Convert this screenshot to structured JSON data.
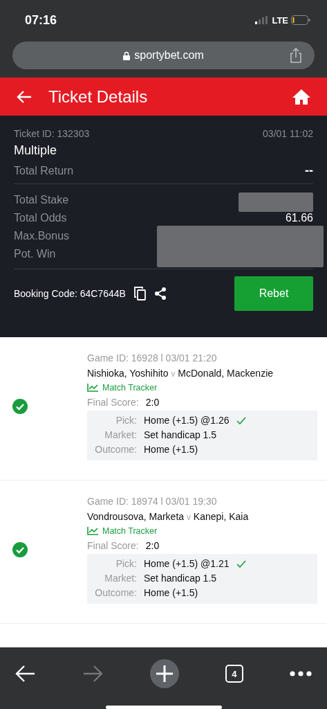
{
  "status_bar": {
    "time": "07:16",
    "network": "LTE"
  },
  "browser": {
    "url": "sportybet.com"
  },
  "header": {
    "title": "Ticket Details"
  },
  "ticket": {
    "id": "Ticket ID: 132303",
    "date": "03/01 11:02",
    "type": "Multiple",
    "total_return_label": "Total Return",
    "total_return": "--",
    "stats": [
      {
        "label": "Total Stake",
        "redacted": true
      },
      {
        "label": "Total Odds",
        "value": "61.66",
        "redacted": false
      },
      {
        "label": "Max.Bonus",
        "redacted": true
      },
      {
        "label": "Pot. Win",
        "redacted": true
      }
    ],
    "booking_code": "Booking Code: 64C7644B",
    "rebet": "Rebet"
  },
  "games": [
    {
      "won": true,
      "meta": "Game ID: 16928 l 03/01 21:20",
      "home": "Nishioka, Yoshihito",
      "vs": "v",
      "away": "McDonald, Mackenzie",
      "tracker": "Match Tracker",
      "score_label": "Final Score:",
      "score": "2:0",
      "pick_label": "Pick:",
      "pick": "Home (+1.5) @1.26",
      "market_label": "Market:",
      "market": "Set handicap 1.5",
      "outcome_label": "Outcome:",
      "outcome": "Home (+1.5)"
    },
    {
      "won": true,
      "meta": "Game ID: 18974 l 03/01 19:30",
      "home": "Vondrousova, Marketa",
      "vs": "v",
      "away": "Kanepi, Kaia",
      "tracker": "Match Tracker",
      "score_label": "Final Score:",
      "score": "2:0",
      "pick_label": "Pick:",
      "pick": "Home (+1.5) @1.21",
      "market_label": "Market:",
      "market": "Set handicap 1.5",
      "outcome_label": "Outcome:",
      "outcome": "Home (+1.5)"
    }
  ],
  "toolbar": {
    "forward_disabled": true,
    "tab_count": "4"
  }
}
